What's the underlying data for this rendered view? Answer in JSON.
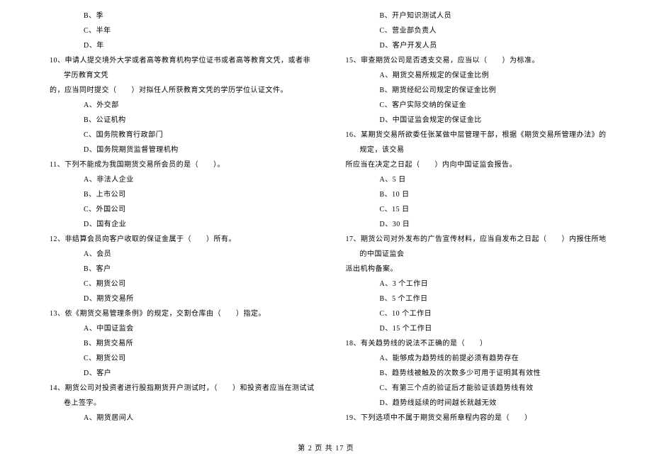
{
  "left_column": {
    "pre_options": [
      "B、季",
      "C、半年",
      "D、年"
    ],
    "q10_line1": "10、申请人提交境外大学或者高等教育机构学位证书或者高等教育文凭，或者非学历教育文凭",
    "q10_line2": "的，应当同时提交（　　）对拟任人所获教育文凭的学历学位认证文件。",
    "q10_opts": [
      "A、外交部",
      "B、公证机构",
      "C、国务院教育行政部门",
      "D、国务院期货监督管理机构"
    ],
    "q11": "11、下列不能成为我国期货交易所会员的是（　　）。",
    "q11_opts": [
      "A、非法人企业",
      "B、上市公司",
      "C、外国公司",
      "D、国有企业"
    ],
    "q12": "12、非结算会员向客户收取的保证金属于（　　）所有。",
    "q12_opts": [
      "A、会员",
      "B、客户",
      "C、期货公司",
      "D、期货交易所"
    ],
    "q13": "13、依《期货交易管理条例》的规定，交割仓库由（　　）指定。",
    "q13_opts": [
      "A、中国证监会",
      "B、期货交易所",
      "C、期货公司",
      "D、客户"
    ],
    "q14": "14、期货公司对投资者进行股指期货开户测试时，（　　）和投资者应当在测试试卷上签字。",
    "q14_opts": [
      "A、期货居间人"
    ]
  },
  "right_column": {
    "pre_options": [
      "B、开户知识测试人员",
      "C、营业部负责人",
      "D、客户开发人员"
    ],
    "q15": "15、审查期货公司是否透支交易，应当以（　　）为标准。",
    "q15_opts": [
      "A、期货交易所规定的保证金比例",
      "B、期货经纪公司规定的保证金比例",
      "C、客户实际交纳的保证金",
      "D、中国证监会规定的保证金比"
    ],
    "q16_line1": "16、某期货交易所欲委任张某做中层管理干部，根据《期货交易所管理办法》的规定，该交易",
    "q16_line2": "所应当在决定之日起（　　）内向中国证监会报告。",
    "q16_opts": [
      "A、5 日",
      "B、10 日",
      "C、15 日",
      "D、30 日"
    ],
    "q17_line1": "17、期货公司对外发布的广告宣传材料，应当自发布之日起（　　）内报住所地的中国证监会",
    "q17_line2": "派出机构备案。",
    "q17_opts": [
      "A、3 个工作日",
      "B、5 个工作日",
      "C、10 个工作日",
      "D、15 个工作日"
    ],
    "q18": "18、有关趋势线的说法不正确的是（　　）",
    "q18_opts": [
      "A、能够成为趋势线的前提必须有趋势存在",
      "B、趋势线被触及的次数多少可用于证明其有效性",
      "C、有第三个点的验证后才能验证该趋势线有效",
      "D、趋势线延续的时间越长就越无效"
    ],
    "q19": "19、下列选项中不属于期货交易所章程内容的是（　　）"
  },
  "footer": "第 2 页 共 17 页"
}
